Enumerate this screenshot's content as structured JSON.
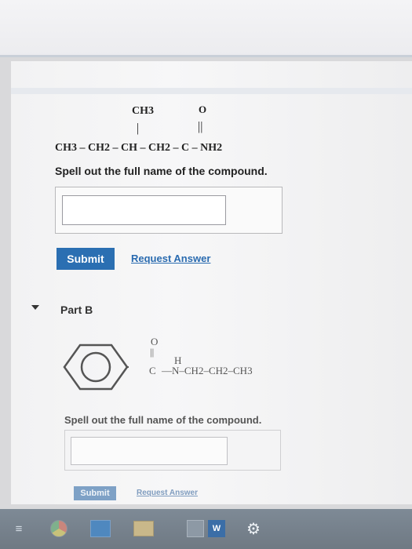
{
  "part_a": {
    "molecule": {
      "substituent": "CH3",
      "carbonyl_o": "O",
      "single_bond": "|",
      "double_bond": "||",
      "chain": "CH3 – CH2 – CH – CH2 – C – NH2"
    },
    "question": "Spell out the full name of the compound.",
    "answer_value": "",
    "submit_label": "Submit",
    "request_label": "Request Answer"
  },
  "part_b": {
    "title": "Part B",
    "molecule": {
      "carbonyl_o": "O",
      "double_bond": "||",
      "h": "H",
      "c": "C",
      "chain": "—N–CH2–CH2–CH3"
    },
    "question": "Spell out the full name of the compound.",
    "answer_value": "",
    "submit_label": "Submit",
    "request_label": "Request Answer"
  },
  "taskbar": {
    "icons": [
      "start-icon",
      "chrome-icon",
      "store-icon",
      "file-explorer-icon",
      "calculator-icon",
      "word-icon",
      "settings-icon"
    ],
    "word_letter": "W"
  },
  "colors": {
    "submit_blue": "#2b6fb2",
    "link_blue": "#2a6bb0",
    "taskbar": "#77828d"
  }
}
